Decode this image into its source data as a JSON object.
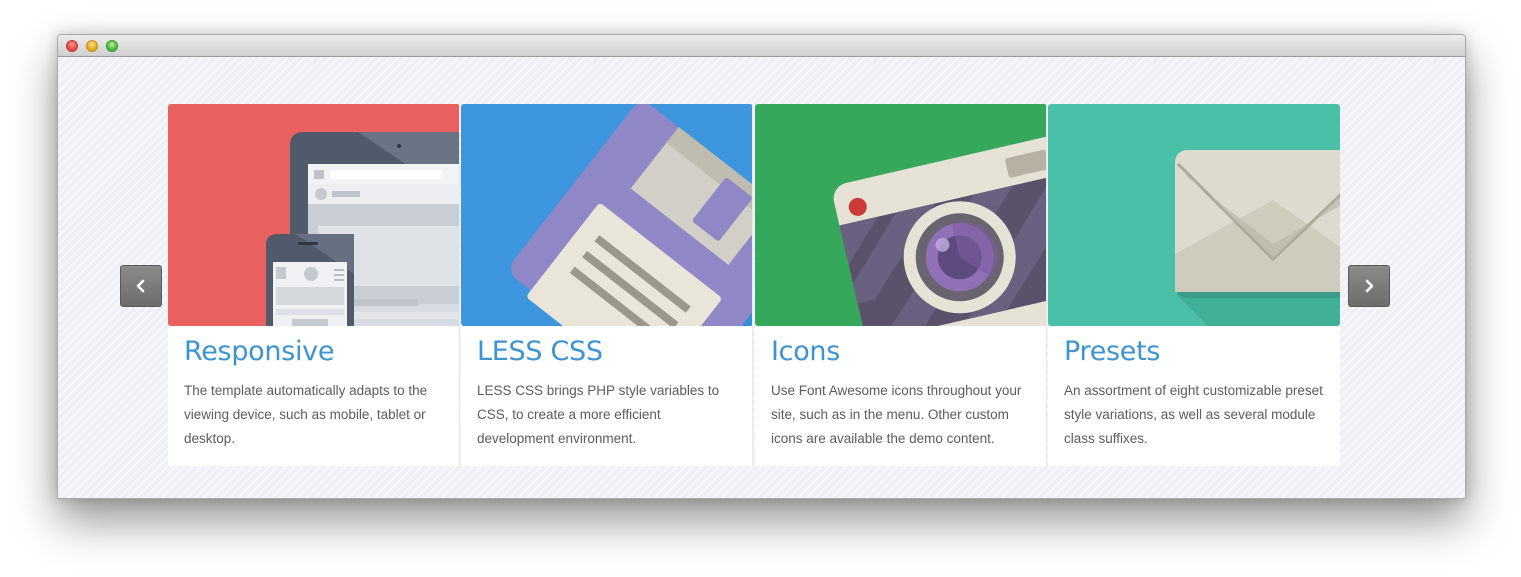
{
  "window": {
    "controls": [
      "close",
      "minimize",
      "zoom"
    ]
  },
  "carousel": {
    "prev_icon": "chevron-left-icon",
    "next_icon": "chevron-right-icon",
    "cards": [
      {
        "title": "Responsive",
        "text": "The template automatically adapts to the viewing device, such as mobile, tablet or desktop.",
        "icon": "devices-illustration",
        "color": "#e9625f"
      },
      {
        "title": "LESS CSS",
        "text": "LESS CSS brings PHP style variables to CSS, to create a more efficient development environment.",
        "icon": "floppy-disk-illustration",
        "color": "#3c95dd"
      },
      {
        "title": "Icons",
        "text": "Use Font Awesome icons throughout your site, such as in the menu. Other custom icons are available the demo content.",
        "icon": "camera-illustration",
        "color": "#36a85c"
      },
      {
        "title": "Presets",
        "text": "An assortment of eight customizable preset style variations, as well as several module class suffixes.",
        "icon": "envelope-illustration",
        "color": "#4bc0a9"
      }
    ]
  }
}
